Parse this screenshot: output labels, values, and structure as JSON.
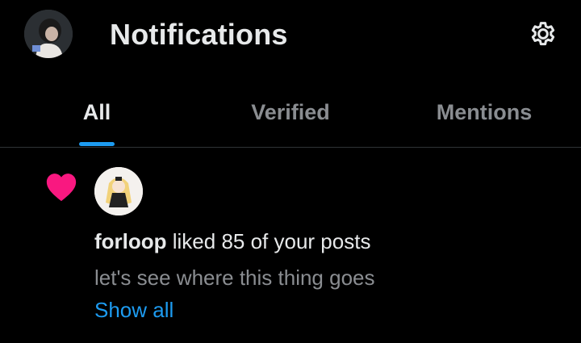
{
  "header": {
    "title": "Notifications",
    "avatar_icon": "user-avatar",
    "settings_icon": "gear-icon"
  },
  "tabs": [
    {
      "label": "All",
      "active": true
    },
    {
      "label": "Verified",
      "active": false
    },
    {
      "label": "Mentions",
      "active": false
    }
  ],
  "notification": {
    "icon": "heart-icon",
    "icon_color": "#f91880",
    "user": "forloop",
    "action": " liked 85 of your posts",
    "preview": "let's see where this thing goes",
    "show_all": "Show all"
  },
  "colors": {
    "background": "#000000",
    "accent": "#1d9bf0",
    "like": "#f91880",
    "text_primary": "#e7e9ea",
    "text_secondary": "#8a8d91"
  }
}
